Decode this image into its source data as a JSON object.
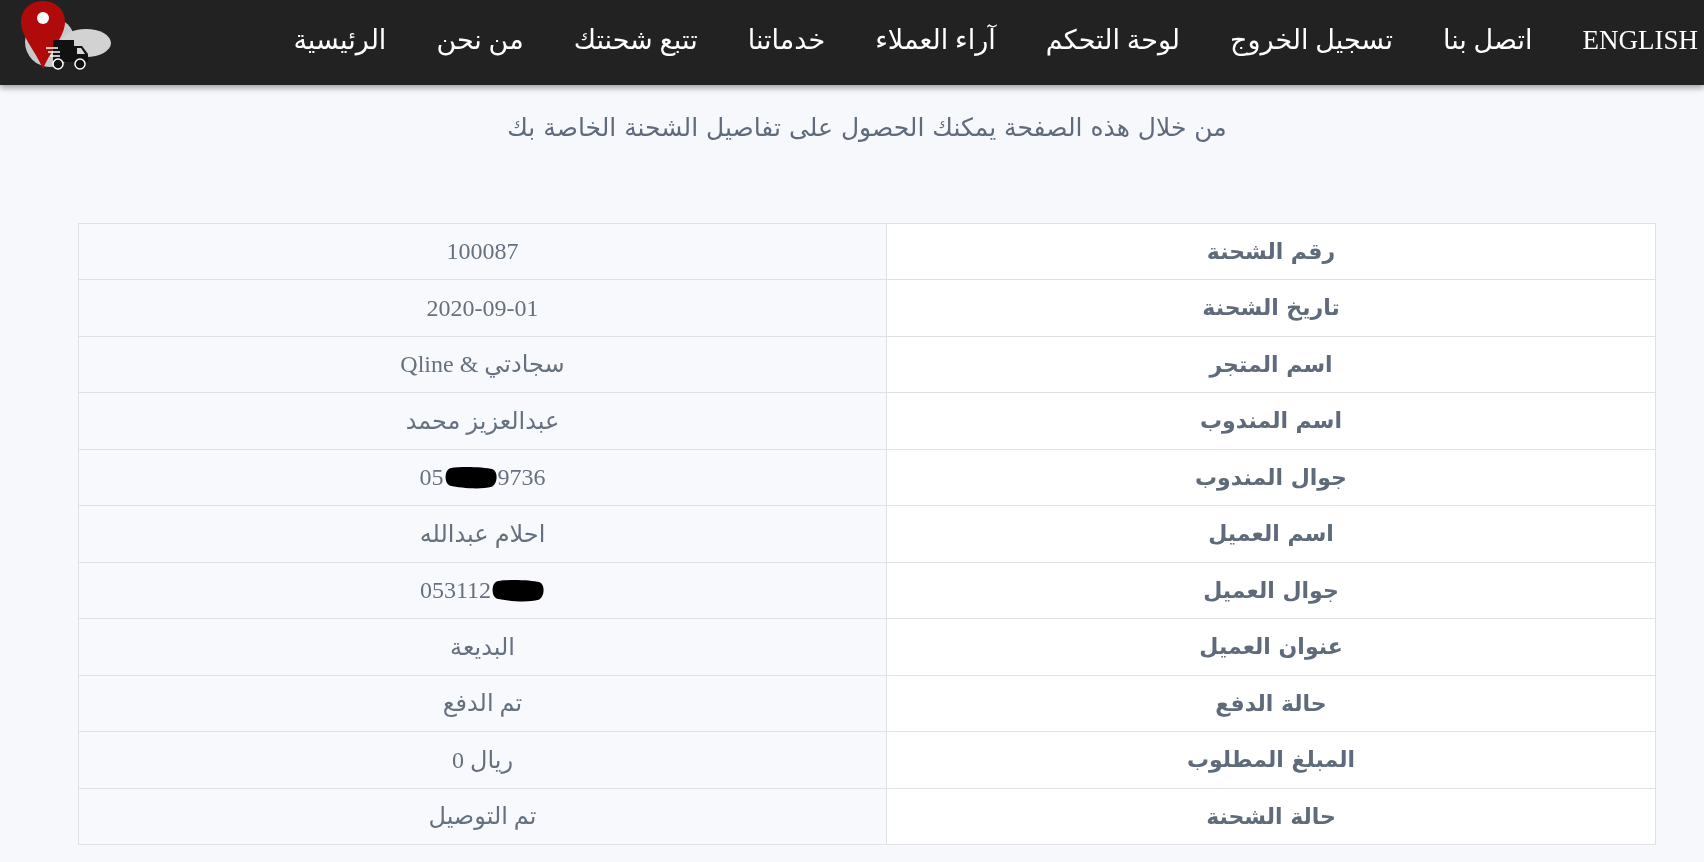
{
  "navbar": {
    "items": [
      {
        "label": "ENGLISH"
      },
      {
        "label": "اتصل بنا"
      },
      {
        "label": "تسجيل الخروج"
      },
      {
        "label": "لوحة التحكم"
      },
      {
        "label": "آراء العملاء"
      },
      {
        "label": "خدماتنا"
      },
      {
        "label": "تتبع شحنتك"
      },
      {
        "label": "من نحن"
      },
      {
        "label": "الرئيسية"
      }
    ]
  },
  "subtitle": "من خلال هذه الصفحة يمكنك الحصول على تفاصيل الشحنة الخاصة بك",
  "shipment_table": {
    "rows": [
      {
        "kind": "text",
        "label": "رقم الشحنة",
        "value": "100087"
      },
      {
        "kind": "text",
        "label": "تاريخ الشحنة",
        "value": "2020-09-01"
      },
      {
        "kind": "text",
        "label": "اسم المتجر",
        "value": "Qline & سجادتي"
      },
      {
        "kind": "text",
        "label": "اسم المندوب",
        "value": "عبدالعزيز محمد"
      },
      {
        "kind": "redacted",
        "label": "جوال المندوب",
        "value": "05",
        "value_after": "9736"
      },
      {
        "kind": "text",
        "label": "اسم العميل",
        "value": "احلام عبدالله"
      },
      {
        "kind": "redacted",
        "label": "جوال العميل",
        "value": "053112"
      },
      {
        "kind": "text",
        "label": "عنوان العميل",
        "value": "البديعة"
      },
      {
        "kind": "text",
        "label": "حالة الدفع",
        "value": "تم الدفع"
      },
      {
        "kind": "text",
        "label": "المبلغ المطلوب",
        "value": "0 ريال"
      },
      {
        "kind": "text",
        "label": "حالة الشحنة",
        "value": "تم التوصيل"
      }
    ]
  }
}
